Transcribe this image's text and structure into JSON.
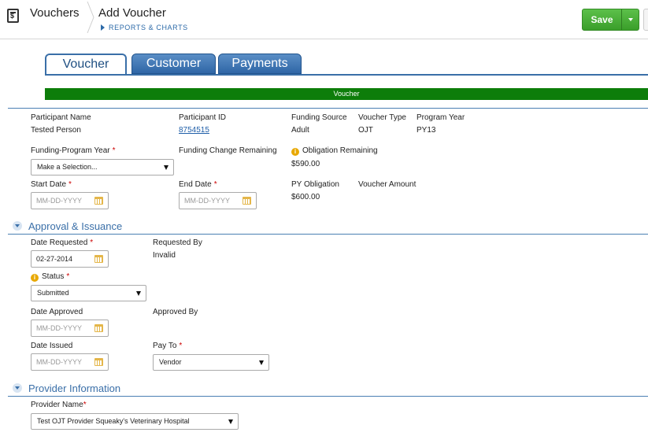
{
  "header": {
    "app_icon": "voucher-icon",
    "breadcrumb_root": "Vouchers",
    "page_title": "Add Voucher",
    "sub_link": "REPORTS & CHARTS",
    "save_label": "Save"
  },
  "tabs": [
    {
      "label": "Voucher",
      "active": true
    },
    {
      "label": "Customer",
      "active": false
    },
    {
      "label": "Payments",
      "active": false
    }
  ],
  "voucher_bar": "Voucher",
  "participant": {
    "name_label": "Participant Name",
    "name_value": "Tested Person",
    "id_label": "Participant ID",
    "id_value": "8754515",
    "funding_source_label": "Funding Source",
    "funding_source_value": "Adult",
    "voucher_type_label": "Voucher Type",
    "voucher_type_value": "OJT",
    "program_year_label": "Program Year",
    "program_year_value": "PY13"
  },
  "funding": {
    "label": "Funding-Program Year",
    "select_value": "Make a Selection...",
    "change_remaining_label": "Funding Change Remaining",
    "obligation_remaining_label": "Obligation Remaining",
    "obligation_remaining_value": "$590.00"
  },
  "dates": {
    "start_label": "Start Date",
    "start_placeholder": "MM-DD-YYYY",
    "end_label": "End Date",
    "end_placeholder": "MM-DD-YYYY",
    "py_obligation_label": "PY Obligation",
    "py_obligation_value": "$600.00",
    "voucher_amount_label": "Voucher Amount"
  },
  "approval": {
    "section_title": "Approval & Issuance",
    "date_requested_label": "Date Requested",
    "date_requested_value": "02-27-2014",
    "requested_by_label": "Requested By",
    "requested_by_value": "Invalid",
    "status_label": "Status",
    "status_value": "Submitted",
    "date_approved_label": "Date Approved",
    "date_approved_placeholder": "MM-DD-YYYY",
    "approved_by_label": "Approved By",
    "date_issued_label": "Date Issued",
    "date_issued_placeholder": "MM-DD-YYYY",
    "pay_to_label": "Pay To",
    "pay_to_value": "Vendor"
  },
  "provider": {
    "section_title": "Provider Information",
    "name_label": "Provider Name",
    "name_value": "Test OJT Provider Squeaky's Veterinary Hospital"
  },
  "required_mark": "*",
  "colors": {
    "accent": "#3a6fa8",
    "save": "#3a9e2a",
    "voucher_bar": "#0d7d0a",
    "required": "#cc0000"
  }
}
